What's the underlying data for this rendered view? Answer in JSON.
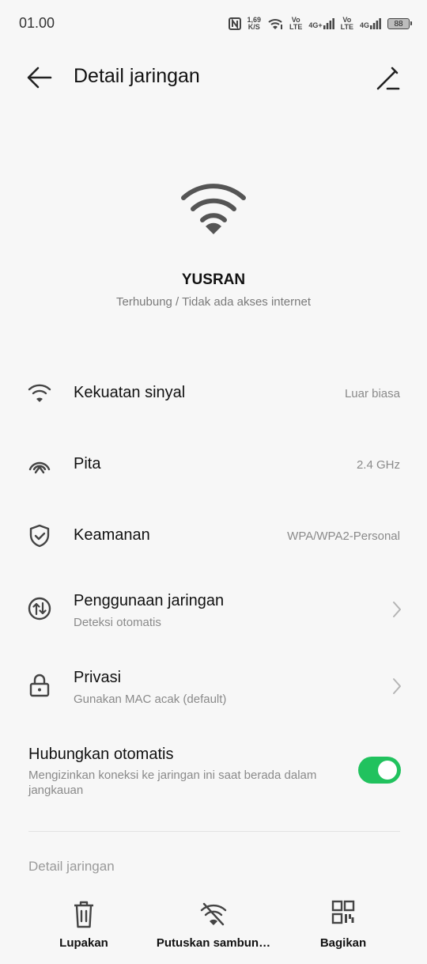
{
  "status_bar": {
    "time": "01.00",
    "speed_value": "1,69",
    "speed_unit": "K/S",
    "volte1_top": "Vo",
    "volte1_bottom": "LTE",
    "net1": "4G+",
    "volte2_top": "Vo",
    "volte2_bottom": "LTE",
    "net2": "4G",
    "battery": "88"
  },
  "header": {
    "title": "Detail jaringan",
    "back_icon": "arrow-left-icon",
    "edit_icon": "edit-pencil-icon"
  },
  "network": {
    "ssid": "YUSRAN",
    "status": "Terhubung / Tidak ada akses internet"
  },
  "rows": [
    {
      "label": "Kekuatan sinyal",
      "value": "Luar biasa",
      "icon": "wifi-signal-icon"
    },
    {
      "label": "Pita",
      "value": "2.4 GHz",
      "icon": "band-icon"
    },
    {
      "label": "Keamanan",
      "value": "WPA/WPA2-Personal",
      "icon": "shield-check-icon"
    },
    {
      "label": "Penggunaan jaringan",
      "sub": "Deteksi otomatis",
      "icon": "data-usage-icon"
    },
    {
      "label": "Privasi",
      "sub": "Gunakan MAC acak (default)",
      "icon": "lock-icon"
    }
  ],
  "auto_connect": {
    "title": "Hubungkan otomatis",
    "description": "Mengizinkan koneksi ke jaringan ini saat berada dalam jangkauan",
    "enabled": true,
    "accent": "#21c25e"
  },
  "section": {
    "title": "Detail jaringan"
  },
  "bottom_actions": [
    {
      "label": "Lupakan",
      "icon": "trash-icon"
    },
    {
      "label": "Putuskan sambun…",
      "icon": "wifi-off-icon"
    },
    {
      "label": "Bagikan",
      "icon": "qr-code-icon"
    }
  ]
}
